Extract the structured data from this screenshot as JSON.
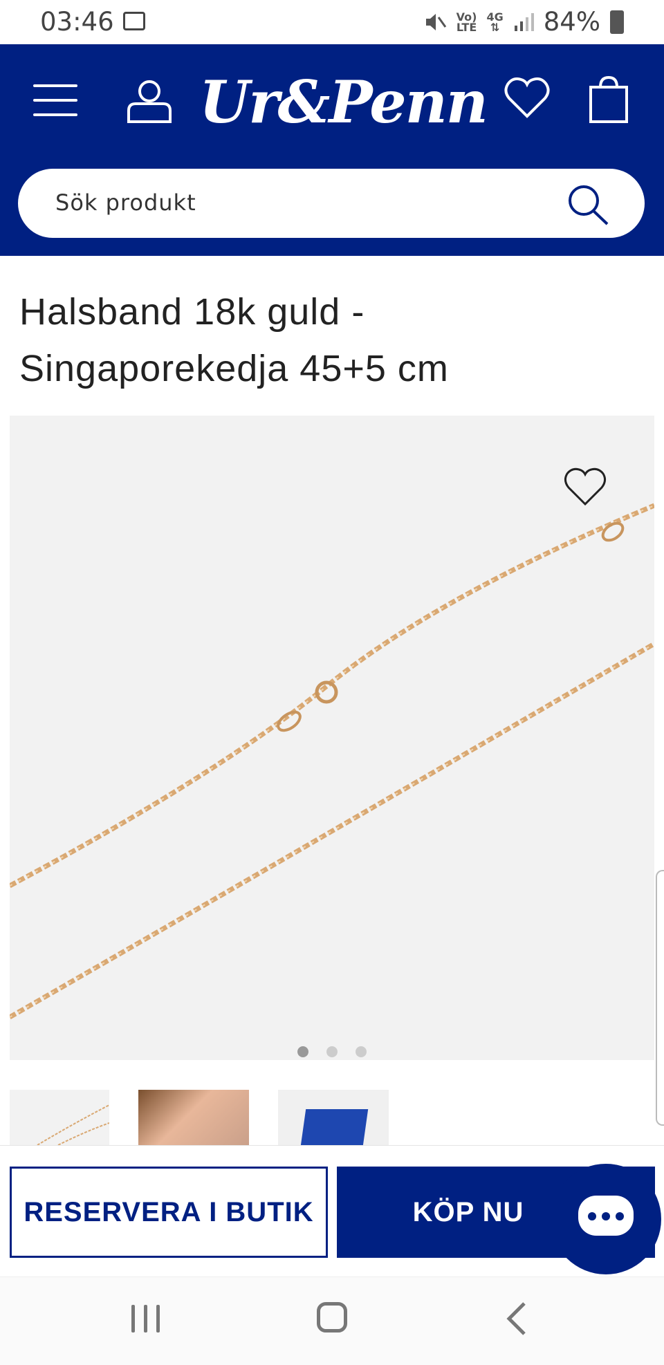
{
  "status_bar": {
    "time": "03:46",
    "signal_tag_top": "Vo)",
    "signal_tag_bottom": "LTE",
    "network": "4G",
    "battery": "84%"
  },
  "header": {
    "logo_text": "Ur&Penn",
    "search_placeholder": "Sök produkt"
  },
  "product": {
    "title_line1": "Halsband 18k guld -",
    "title_line2": "Singaporekedja 45+5 cm",
    "gallery": {
      "total_images": 3,
      "active_index": 0
    }
  },
  "actions": {
    "reserve_label": "RESERVERA I BUTIK",
    "buy_label": "KÖP NU"
  },
  "colors": {
    "brand": "#002082",
    "background": "#ffffff",
    "image_bg": "#f2f2f2",
    "chain_gold": "#d9a872"
  },
  "icons": [
    "menu-icon",
    "user-icon",
    "heart-icon",
    "bag-icon",
    "search-icon",
    "chat-icon",
    "nav-recent-icon",
    "nav-home-icon",
    "nav-back-icon"
  ]
}
